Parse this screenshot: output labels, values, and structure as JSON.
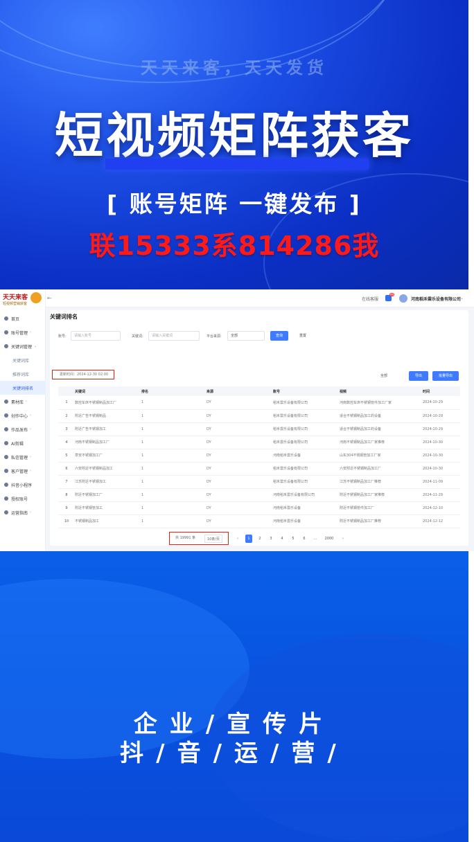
{
  "banner_top": {
    "slogan": "天天来客，天天发货",
    "headline": "短视频矩阵获客",
    "subline": "[ 账号矩阵 一键发布 ]",
    "contact": "联15333系814286我"
  },
  "app": {
    "logo_title": "天天来客",
    "logo_subtitle": "短视频营销获客",
    "nav": [
      {
        "label": "首页",
        "icon": "home-icon"
      },
      {
        "label": "账号管理",
        "icon": "account-icon",
        "arrow": "›"
      },
      {
        "label": "关键词管理",
        "icon": "keyword-icon",
        "arrow": "⌄"
      },
      {
        "label": "关键词库",
        "sub": true
      },
      {
        "label": "推荐词库",
        "sub": true
      },
      {
        "label": "关键词排名",
        "sub": true,
        "active": true
      },
      {
        "label": "素材库",
        "icon": "material-icon",
        "arrow": "›"
      },
      {
        "label": "创作中心",
        "icon": "create-icon",
        "arrow": "›"
      },
      {
        "label": "作品发布",
        "icon": "publish-icon",
        "arrow": "›"
      },
      {
        "label": "AI剪辑",
        "icon": "ai-icon"
      },
      {
        "label": "私信管理",
        "icon": "message-icon",
        "arrow": "›"
      },
      {
        "label": "客户管理",
        "icon": "customer-icon",
        "arrow": "›"
      },
      {
        "label": "抖音小程序",
        "icon": "miniapp-icon"
      },
      {
        "label": "授权账号",
        "icon": "auth-icon"
      },
      {
        "label": "运营指南",
        "icon": "guide-icon",
        "arrow": "›"
      }
    ],
    "topbar": {
      "link": "在线客服",
      "badge": "99",
      "company": "河南稻禾雲乐设备有限公司"
    },
    "page_title": "关键词排名",
    "filters": {
      "account_label": "账号:",
      "account_placeholder": "请输入账号",
      "keyword_label": "关键词:",
      "keyword_placeholder": "请输入关键词",
      "source_label": "平台来源:",
      "source_value": "全部",
      "search_button": "查询",
      "reset_button": "重置"
    },
    "update_time": "更新时间：2024-12-30 02:00",
    "select_all": "全部",
    "export_button": "导出",
    "batch_button": "批量导出",
    "table": {
      "headers": [
        "",
        "关键词",
        "排名",
        "来源",
        "账号",
        "视频",
        "时间"
      ],
      "rows": [
        [
          "1",
          "数控车床不锈钢制品加工厂",
          "1",
          "DY",
          "稻禾雲乐设备有限公司",
          "河南数控车床不锈钢管件加工厂家",
          "2024-10-29"
        ],
        [
          "2",
          "附近广告不锈钢制品",
          "1",
          "DY",
          "稻禾雲乐设备有限公司",
          "适合不锈钢制品加工的设备",
          "2024-10-29"
        ],
        [
          "3",
          "附近广告不锈钢加工",
          "1",
          "DY",
          "稻禾雲乐设备有限公司",
          "适合不锈钢制品加工的设备",
          "2024-10-29"
        ],
        [
          "4",
          "河南不锈钢制品加工厂",
          "1",
          "DY",
          "稻禾雲乐设备有限公司",
          "河南不锈钢制品加工厂家推荐",
          "2024-10-30"
        ],
        [
          "5",
          "草安不锈钢加工厂",
          "1",
          "DY",
          "河南稻禾雲乐设备",
          "山东304不锈钢管加工厂家",
          "2024-10-30"
        ],
        [
          "6",
          "六安附近不锈钢制品加工",
          "1",
          "DY",
          "稻禾雲乐设备有限公司",
          "六安附近不锈钢制品加工厂",
          "2024-10-30"
        ],
        [
          "7",
          "江苏附近不锈钢加工",
          "1",
          "DY",
          "稻禾雲乐设备有限公司",
          "江苏不锈钢制品加工厂推荐",
          "2024-11-09"
        ],
        [
          "8",
          "附近不锈钢加工厂",
          "1",
          "DY",
          "河南稻禾雲乐设备有限公司",
          "附近不锈钢制品加工厂家推荐",
          "2024-11-29"
        ],
        [
          "9",
          "附近不锈钢管加工",
          "1",
          "DY",
          "河南稻禾雲乐设备",
          "附近不锈钢管件加工厂",
          "2024-12-10"
        ],
        [
          "10",
          "不锈钢制品加工",
          "1",
          "DY",
          "河南稻禾雲乐设备",
          "附近不锈钢制品加工厂推荐",
          "2024-12-12"
        ]
      ]
    },
    "pager": {
      "total": "共 19991 条",
      "page_size": "10条/页",
      "pages": [
        "‹",
        "1",
        "2",
        "3",
        "4",
        "5",
        "6",
        "…",
        "2000",
        "›"
      ],
      "current": "1"
    }
  },
  "banner_bottom": {
    "line1": "企业/宣传片",
    "line2": "抖/音/运/营/"
  }
}
